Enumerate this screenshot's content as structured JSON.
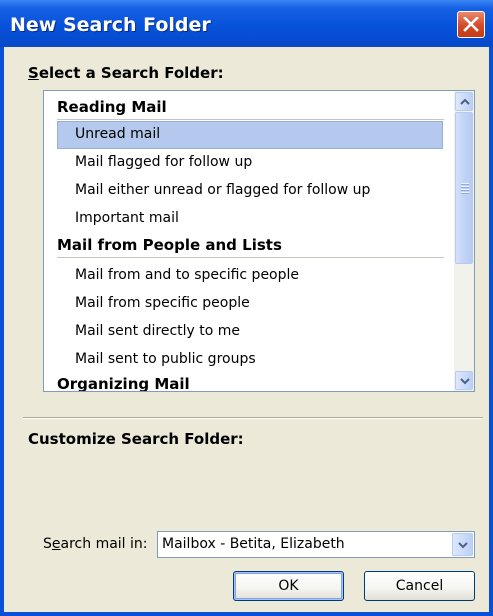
{
  "window": {
    "title": "New Search Folder"
  },
  "select_section": {
    "heading_mnemonic": "S",
    "heading_rest": "elect a Search Folder:"
  },
  "folder_list": {
    "groups": [
      {
        "label": "Reading Mail",
        "items": [
          "Unread mail",
          "Mail flagged for follow up",
          "Mail either unread or flagged for follow up",
          "Important mail"
        ]
      },
      {
        "label": "Mail from People and Lists",
        "items": [
          "Mail from and to specific people",
          "Mail from specific people",
          "Mail sent directly to me",
          "Mail sent to public groups"
        ]
      },
      {
        "label": "Organizing Mail",
        "items": []
      }
    ],
    "selected_item": "Unread mail"
  },
  "customize_section": {
    "heading": "Customize Search Folder:"
  },
  "search_in": {
    "label_before": "S",
    "label_mnemonic": "e",
    "label_after": "arch mail in:",
    "value": "Mailbox - Betita, Elizabeth"
  },
  "buttons": {
    "ok_label": "OK",
    "cancel_label": "Cancel"
  }
}
